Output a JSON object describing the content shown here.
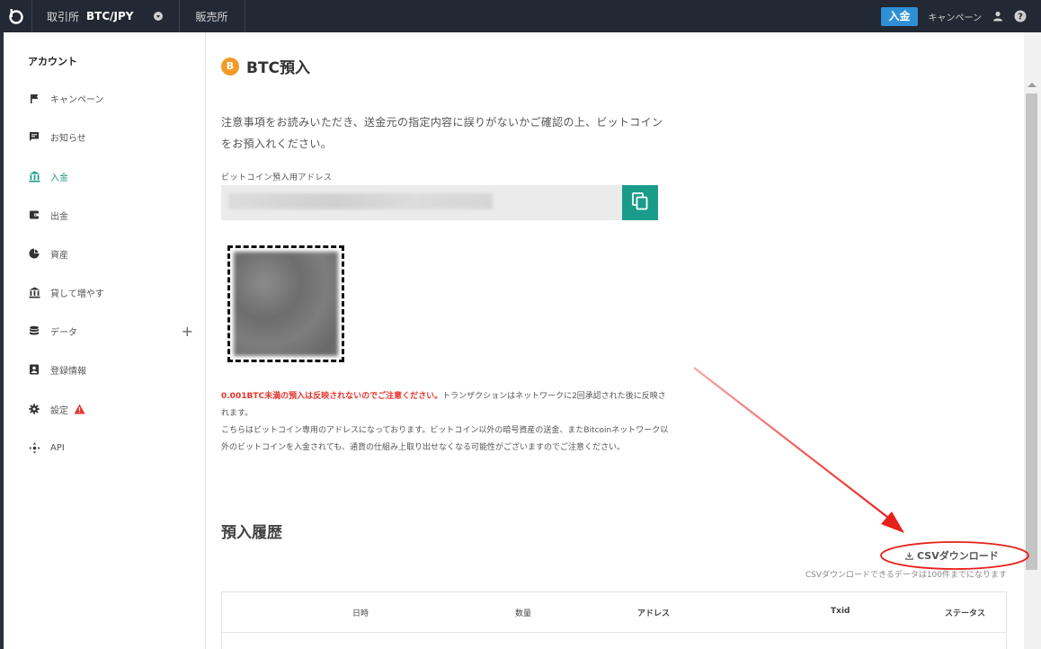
{
  "topbar": {
    "exchange_label": "取引所",
    "pair": "BTC/JPY",
    "sales_label": "販売所",
    "deposit_button": "入金",
    "campaign_label": "キャンペーン"
  },
  "sidebar": {
    "title": "アカウント",
    "items": [
      {
        "label": "キャンペーン",
        "icon": "flag-icon"
      },
      {
        "label": "お知らせ",
        "icon": "message-icon"
      },
      {
        "label": "入金",
        "icon": "bank-icon",
        "active": true
      },
      {
        "label": "出金",
        "icon": "wallet-icon"
      },
      {
        "label": "資産",
        "icon": "pie-icon"
      },
      {
        "label": "貸して増やす",
        "icon": "lend-icon"
      },
      {
        "label": "データ",
        "icon": "database-icon",
        "expand": "+"
      },
      {
        "label": "登録情報",
        "icon": "profile-icon"
      },
      {
        "label": "設定",
        "icon": "gear-icon",
        "warning": true
      },
      {
        "label": "API",
        "icon": "api-icon"
      }
    ]
  },
  "main": {
    "btc_symbol": "B",
    "title": "BTC預入",
    "intro": "注意事項をお読みいただき、送金元の指定内容に誤りがないかご確認の上、ビットコインをお預入れください。",
    "address_label": "ビットコイン預入用アドレス",
    "notice_red": "0.001BTC未満の預入は反映されないのでご注意ください。",
    "notice_rest": "トランザクションはネットワークに2回承認された後に反映されます。",
    "notice_2": "こちらはビットコイン専用のアドレスになっております。ビットコイン以外の暗号資産の送金、またBitcoinネットワーク以外のビットコインを入金されても、通貨の仕組み上取り出せなくなる可能性がございますのでご注意ください。",
    "history_title": "預入履歴",
    "csv_button": "CSVダウンロード",
    "csv_note": "CSVダウンロードできるデータは100件までになります",
    "table_headers": [
      "日時",
      "数量",
      "アドレス",
      "Txid",
      "ステータス"
    ]
  },
  "colors": {
    "accent": "#1a9c8a",
    "topbar": "#222834",
    "deposit_button": "#2f8fd6",
    "btc_orange": "#f39a28",
    "warning_red": "#e5342c",
    "annotation_red": "#e8201a"
  }
}
